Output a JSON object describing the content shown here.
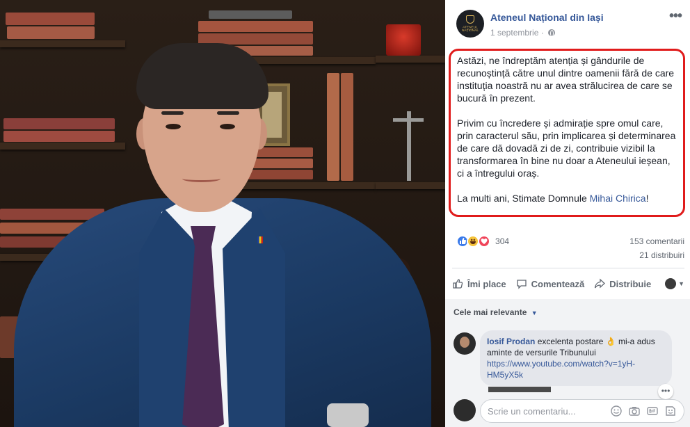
{
  "post": {
    "page_name": "Ateneul Național din Iași",
    "date": "1 septembrie",
    "date_separator": "·",
    "avatar_text": "ATENEUL NAȚIONAL",
    "paragraph1": "Astăzi, ne îndreptăm atenția și gândurile de recunoștință către unul dintre oamenii fără de care instituția noastră nu ar avea strălucirea de care se bucură în prezent.",
    "paragraph2": "Privim cu încredere și admirație spre omul care, prin caracterul său, prin implicarea și determinarea de care dă dovadă zi de zi, contribuie vizibil la transformarea în bine nu doar a Ateneului ieșean, ci a întregului oraș.",
    "paragraph3_prefix": "La multi ani, Stimate Domnule ",
    "mention": "Mihai Chirica",
    "paragraph3_suffix": "!",
    "highlight_color": "#e01b1b"
  },
  "stats": {
    "reaction_count": "304",
    "comments": "153 comentarii",
    "shares": "21 distribuiri",
    "reactions": [
      "like-icon",
      "haha-icon",
      "love-icon"
    ]
  },
  "actions": {
    "like": "Îmi place",
    "comment": "Comentează",
    "share": "Distribuie"
  },
  "comments": {
    "sort_label": "Cele mai relevante",
    "items": [
      {
        "author": "Iosif Prodan",
        "text": "excelenta postare 👌 mi-a adus aminte de versurile Tribunului",
        "link": "https://www.youtube.com/watch?v=1yH-HM5yX5k"
      }
    ],
    "composer_placeholder": "Scrie un comentariu..."
  },
  "colors": {
    "link": "#365899",
    "muted": "#90949c",
    "panel_bg": "#ffffff",
    "comments_bg": "#f2f3f5"
  }
}
